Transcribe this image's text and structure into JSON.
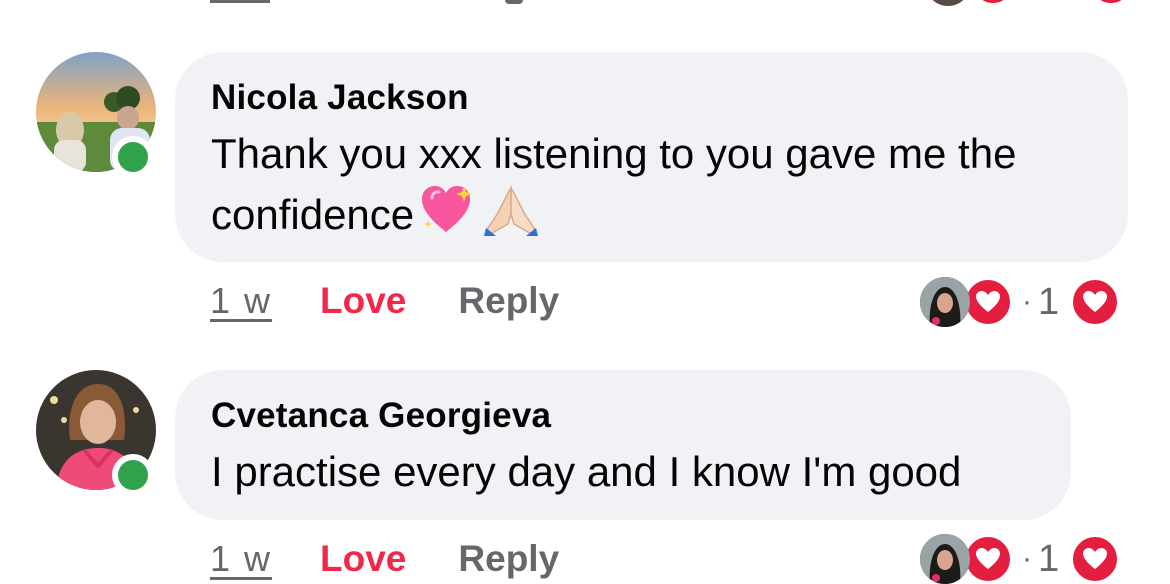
{
  "colors": {
    "bubble": "#f0f2f5",
    "love": "#f02849",
    "secondary": "#65676b",
    "online": "#31a24c",
    "reaction_heart": "#e41e3f"
  },
  "comments": [
    {
      "author": "Nicola Jackson",
      "text": "Thank you xxx listening to you gave me the confidence",
      "emojis": [
        "sparkling-heart",
        "folded-hands"
      ],
      "online": true,
      "time": "1 w",
      "love_label": "Love",
      "reply_label": "Reply",
      "reaction_separator": "·",
      "reaction_count": "1",
      "reaction_icon": "heart-icon"
    },
    {
      "author": "Cvetanca Georgieva",
      "text": "I practise every day and I know I'm good",
      "emojis": [],
      "online": true,
      "time": "1 w",
      "love_label": "Love",
      "reply_label": "Reply",
      "reaction_separator": "·",
      "reaction_count": "1",
      "reaction_icon": "heart-icon"
    }
  ]
}
